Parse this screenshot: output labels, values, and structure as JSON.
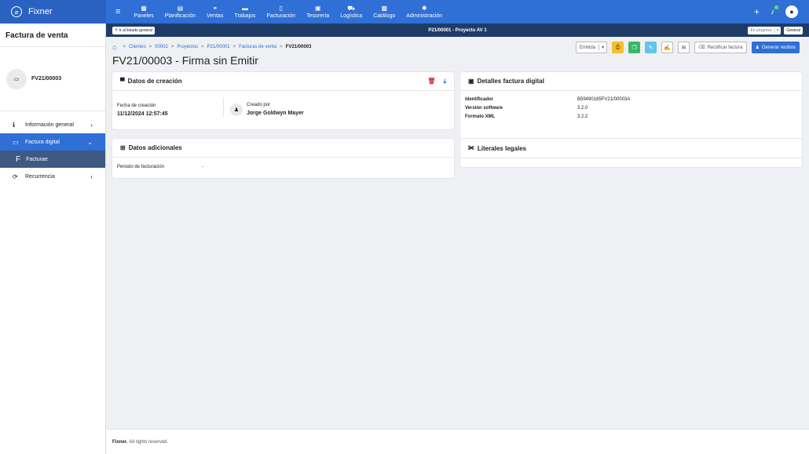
{
  "app": {
    "name": "Fixner"
  },
  "nav": {
    "items": [
      {
        "label": "Paneles",
        "icon": "grid-icon"
      },
      {
        "label": "Planificación",
        "icon": "calendar-icon"
      },
      {
        "label": "Ventas",
        "icon": "handshake-icon"
      },
      {
        "label": "Trabajos",
        "icon": "folder-icon"
      },
      {
        "label": "Facturación",
        "icon": "invoice-icon"
      },
      {
        "label": "Tesorería",
        "icon": "cash-icon"
      },
      {
        "label": "Logística",
        "icon": "truck-icon"
      },
      {
        "label": "Catálogo",
        "icon": "catalog-icon"
      },
      {
        "label": "Administración",
        "icon": "gear-icon"
      }
    ],
    "notifications_count": "0"
  },
  "sidebar": {
    "title": "Factura de venta",
    "record_id": "FV21/00003",
    "items": [
      {
        "label": "Información general",
        "icon": "info-icon"
      },
      {
        "label": "Factura digital",
        "icon": "devices-icon"
      },
      {
        "label": "Facturae",
        "icon": "letter-f-icon"
      },
      {
        "label": "Recurrencia",
        "icon": "recurrence-icon"
      }
    ]
  },
  "subheader": {
    "back_label": "Ir al listado general",
    "record_title": "P21/00001 - Proyecto AV 1",
    "status_select": "En progreso",
    "general_label": "General"
  },
  "breadcrumb": [
    "Clientes",
    "00002",
    "Proyectos",
    "P21/00001",
    "Facturas de venta",
    "FV21/00003"
  ],
  "page": {
    "title": "FV21/00003 - Firma sin Emitir"
  },
  "actions": {
    "status_label": "Emitida",
    "rectify_label": "Rectificar factura",
    "generate_label": "Generar recibos"
  },
  "creation": {
    "title": "Datos de creación",
    "date_label": "Fecha de creación",
    "date_value": "11/12/2024 12:57:45",
    "creator_label": "Creado por",
    "creator_value": "Jorge Goldwyn Mayer"
  },
  "additional": {
    "title": "Datos adicionales",
    "period_label": "Periodo de facturación",
    "period_value": "-"
  },
  "digital": {
    "title": "Detalles factura digital",
    "rows": [
      {
        "label": "Identificador",
        "value": "B59490185FV21/00003A"
      },
      {
        "label": "Versión software",
        "value": "3.2.0"
      },
      {
        "label": "Formato XML",
        "value": "3.2.2"
      }
    ]
  },
  "legal": {
    "title": "Literales legales"
  },
  "footer": {
    "brand": "Fixner.",
    "text": "All rights reserved."
  }
}
